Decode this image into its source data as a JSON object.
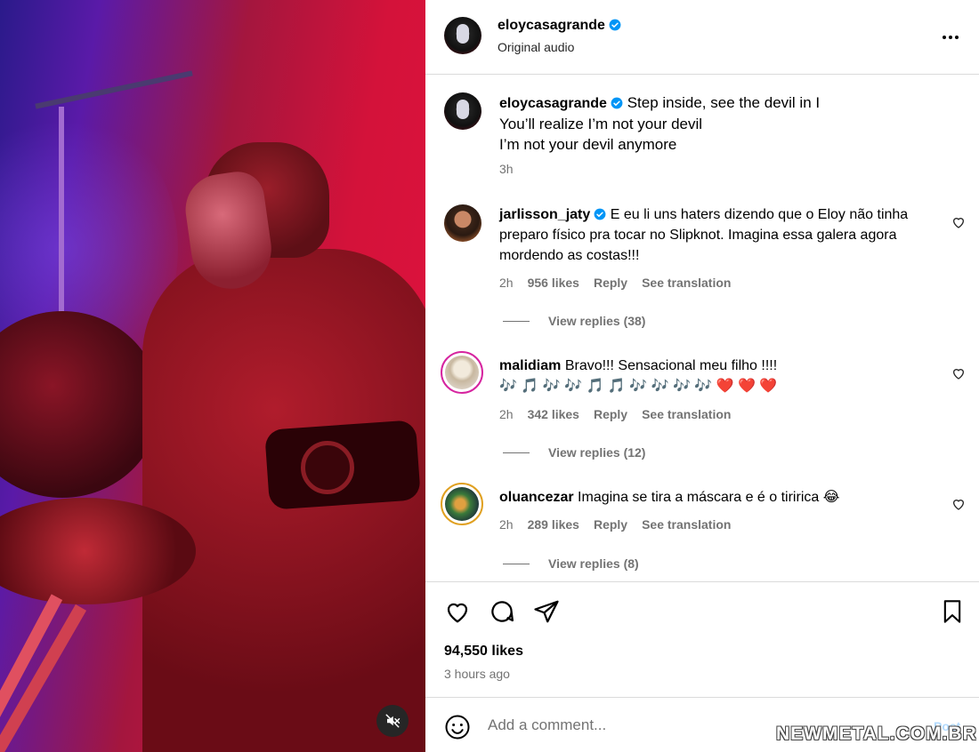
{
  "post": {
    "author": "eloycasagrande",
    "audio": "Original audio",
    "caption_lines": [
      "Step inside, see the devil in I",
      "You’ll realize I’m not your devil",
      "I’m not your devil anymore"
    ],
    "caption_time": "3h"
  },
  "comments": [
    {
      "username": "jarlisson_jaty",
      "verified": true,
      "text": "E eu li uns haters dizendo que o Eloy não tinha preparo físico pra tocar no Slipknot. Imagina essa galera agora mordendo as costas!!!",
      "time": "2h",
      "likes": "956 likes",
      "reply": "Reply",
      "translate": "See translation",
      "view_replies": "View replies (38)"
    },
    {
      "username": "malidiam",
      "verified": false,
      "text": "Bravo!!! Sensacional meu filho !!!!",
      "emoji_line": "🎶 🎵 🎶 🎶 🎵 🎵 🎶 🎶 🎶 🎶 ❤️ ❤️ ❤️",
      "time": "2h",
      "likes": "342 likes",
      "reply": "Reply",
      "translate": "See translation",
      "view_replies": "View replies (12)"
    },
    {
      "username": "oluancezar",
      "verified": false,
      "text": "Imagina se tira a máscara e é o tiririca 😂",
      "time": "2h",
      "likes": "289 likes",
      "reply": "Reply",
      "translate": "See translation",
      "view_replies": "View replies (8)"
    }
  ],
  "footer": {
    "likes": "94,550 likes",
    "ago": "3 hours ago",
    "comment_placeholder": "Add a comment...",
    "post_label": "Post"
  },
  "watermark": "NEWMETAL.COM.BR",
  "colors": {
    "verified": "#0095f6",
    "secondary_text": "#737373",
    "border": "#dbdbdb",
    "post_disabled": "#b3dbff"
  },
  "icons": [
    "volume-off-icon",
    "more-icon",
    "verified-icon",
    "heart-icon",
    "comment-icon",
    "share-icon",
    "bookmark-icon",
    "emoji-icon"
  ]
}
